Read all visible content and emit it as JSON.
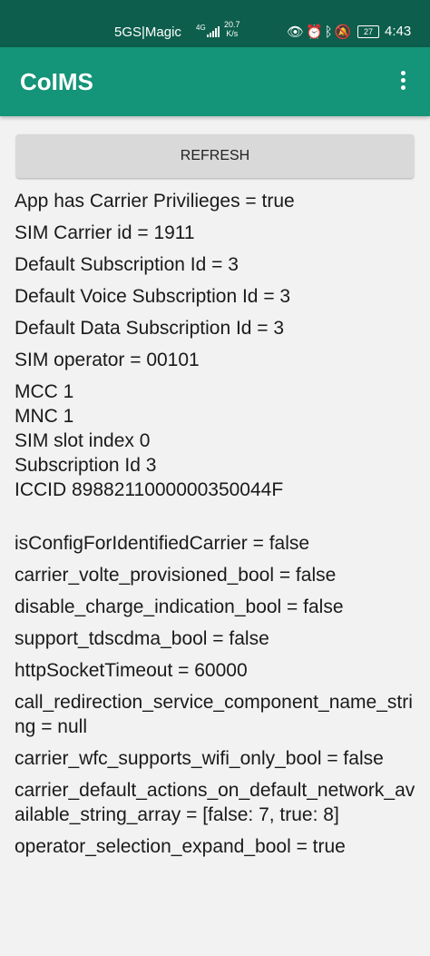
{
  "status_bar": {
    "carrier": "5GS|Magic",
    "network_type": "4G",
    "speed_value": "20.7",
    "speed_unit": "K/s",
    "icons": [
      "eye-icon",
      "alarm-icon",
      "bluetooth-icon",
      "mute-icon"
    ],
    "battery": "27",
    "time": "4:43"
  },
  "app_bar": {
    "title": "CoIMS"
  },
  "refresh_label": "REFRESH",
  "info_group1": [
    "App has Carrier Privilieges = true",
    "SIM Carrier id = 1911",
    "Default Subscription Id = 3",
    "Default Voice Subscription Id = 3",
    "Default Data Subscription Id = 3",
    "SIM operator = 00101"
  ],
  "info_group2": [
    "MCC 1",
    "MNC 1",
    "SIM slot index 0",
    "Subscription Id 3",
    "ICCID 8988211000000350044F"
  ],
  "info_group3": [
    "isConfigForIdentifiedCarrier = false",
    "carrier_volte_provisioned_bool = false",
    "disable_charge_indication_bool = false",
    "support_tdscdma_bool = false",
    "httpSocketTimeout = 60000",
    "call_redirection_service_component_name_string = null",
    "carrier_wfc_supports_wifi_only_bool = false",
    "carrier_default_actions_on_default_network_available_string_array = [false: 7, true: 8]",
    "operator_selection_expand_bool = true"
  ],
  "colors": {
    "status_bar": "#0d5e4d",
    "app_bar": "#149478",
    "background": "#f2f2f2",
    "button": "#d9d9d9"
  }
}
